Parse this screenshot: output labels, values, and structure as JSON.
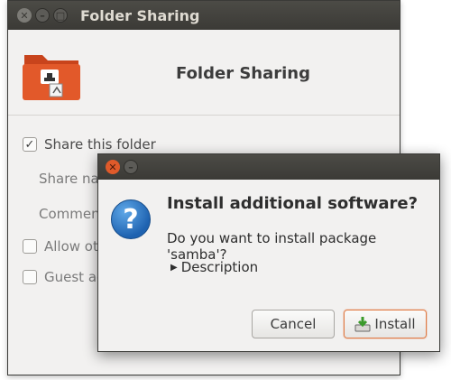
{
  "main_window": {
    "title": "Folder Sharing",
    "header_title": "Folder Sharing",
    "options": {
      "share_this_folder": "Share this folder",
      "share_name_label": "Share na",
      "comment_label": "Commen",
      "allow_others_label": "Allow ot",
      "guest_access_label": "Guest ac"
    },
    "share_this_folder_checked": true
  },
  "dialog": {
    "heading": "Install additional software?",
    "question": "Do you want to install package 'samba'?",
    "expander_label": "Description",
    "cancel_label": "Cancel",
    "install_label": "Install"
  },
  "icons": [
    "close-icon",
    "minimize-icon",
    "maximize-icon",
    "folder-icon",
    "question-icon",
    "install-icon"
  ],
  "colors": {
    "titlebar": "#3b3a36",
    "close_button_active": "#e05a2a",
    "folder_orange": "#e2592a",
    "question_blue": "#1e62b0",
    "install_border": "#e07c46"
  }
}
